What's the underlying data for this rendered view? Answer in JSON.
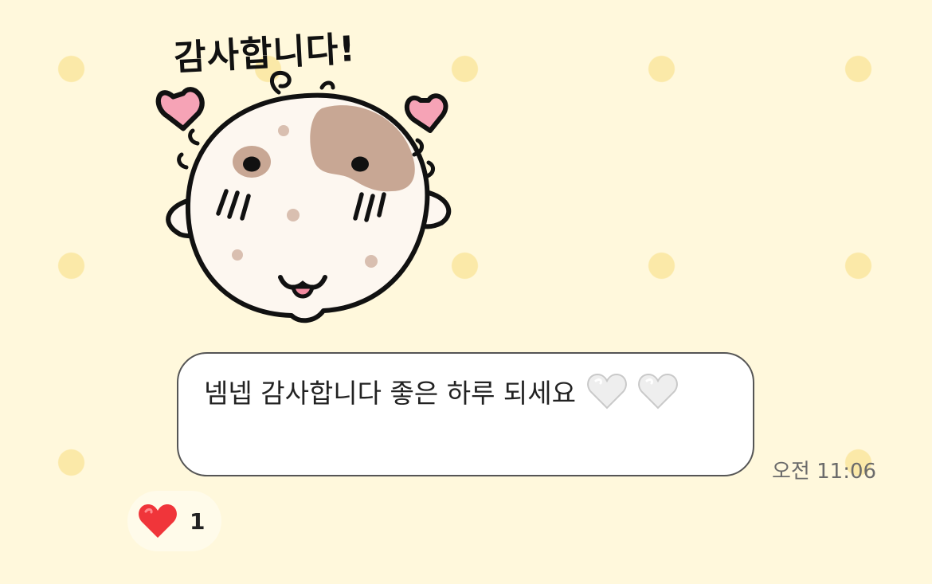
{
  "sticker": {
    "caption": "감사합니다!",
    "description": "hamster-thank-you-sticker"
  },
  "message": {
    "text": "넴넵 감사합니다 좋은 하루 되세요",
    "emojis": [
      "white-heart-icon",
      "white-heart-icon"
    ],
    "time": "오전 11:06",
    "bubble_color": "#ffffff",
    "border_color": "#555555"
  },
  "reaction": {
    "icon": "red-heart-icon",
    "count": "1",
    "color": "#f0353a"
  },
  "theme": {
    "background": "#fff8dc",
    "dot_color": "#fbe9a8"
  }
}
